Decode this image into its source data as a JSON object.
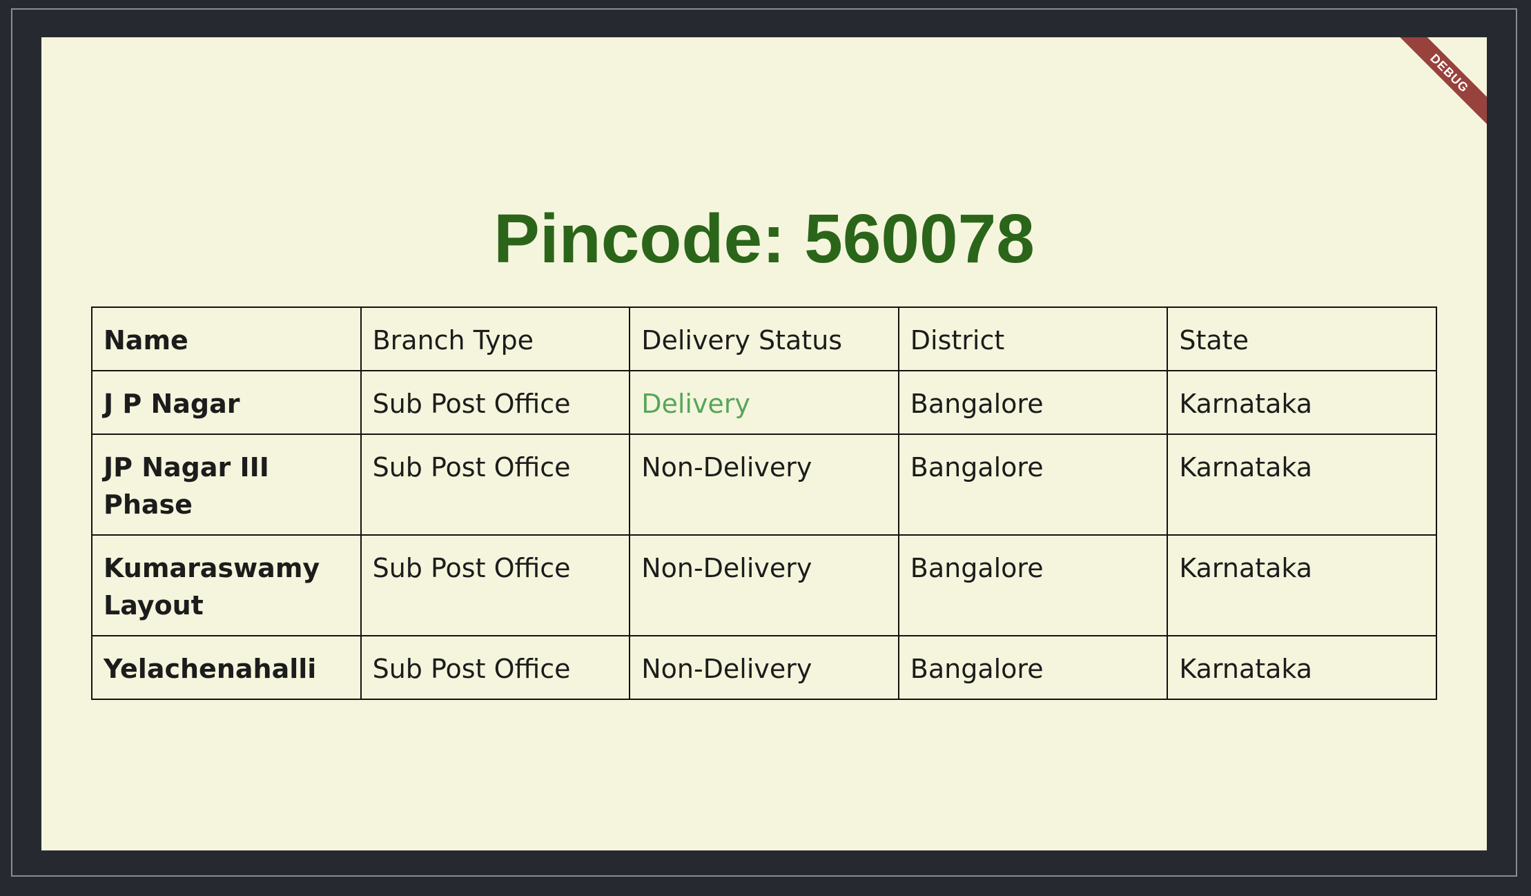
{
  "title": "Pincode: 560078",
  "debug_label": "DEBUG",
  "colors": {
    "title": "#2b6519",
    "delivery": "#57a659",
    "background": "#f5f5dd",
    "frame": "#262a30"
  },
  "table": {
    "headers": [
      "Name",
      "Branch Type",
      "Delivery Status",
      "District",
      "State"
    ],
    "rows": [
      {
        "name": "J P Nagar",
        "branch_type": "Sub Post Office",
        "delivery_status": "Delivery",
        "district": "Bangalore",
        "state": "Karnataka"
      },
      {
        "name": "JP Nagar III Phase",
        "branch_type": "Sub Post Office",
        "delivery_status": "Non-Delivery",
        "district": "Bangalore",
        "state": "Karnataka"
      },
      {
        "name": "Kumaraswamy Layout",
        "branch_type": "Sub Post Office",
        "delivery_status": "Non-Delivery",
        "district": "Bangalore",
        "state": "Karnataka"
      },
      {
        "name": "Yelachenahalli",
        "branch_type": "Sub Post Office",
        "delivery_status": "Non-Delivery",
        "district": "Bangalore",
        "state": "Karnataka"
      }
    ]
  }
}
